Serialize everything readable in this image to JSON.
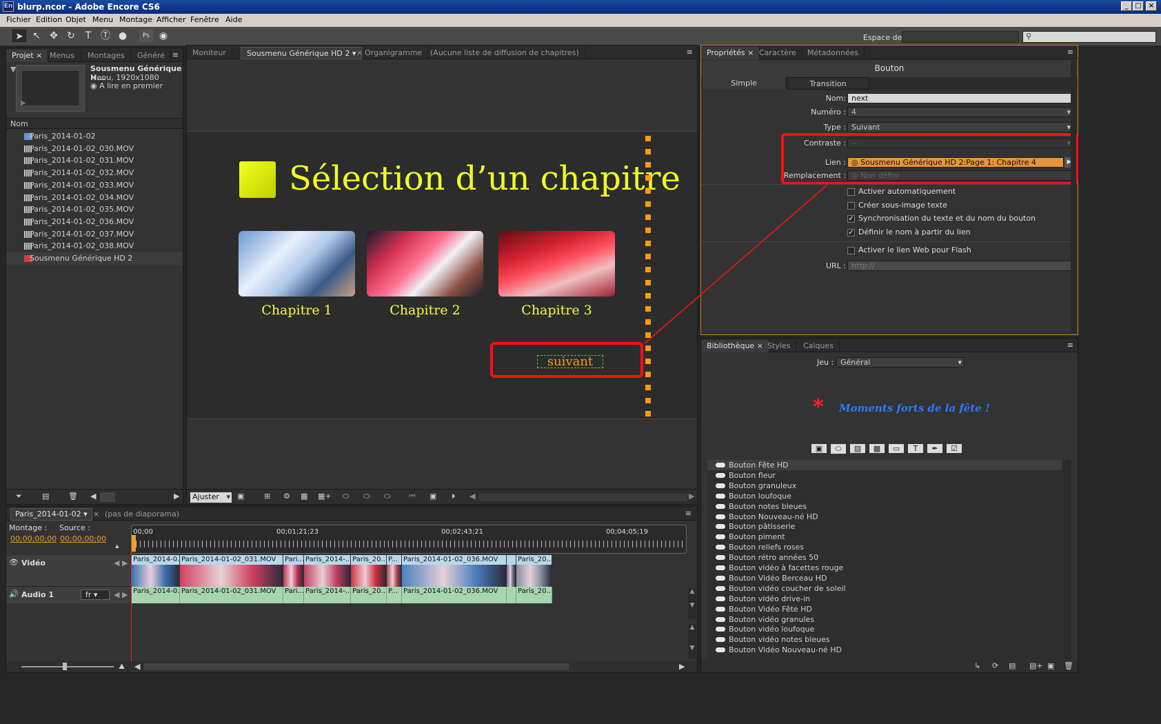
{
  "window": {
    "title": "blurp.ncor - Adobe Encore CS6",
    "app_icon": "En"
  },
  "menu": [
    "Fichier",
    "Edition",
    "Objet",
    "Menu",
    "Montage",
    "Afficher",
    "Fenêtre",
    "Aide"
  ],
  "toolbar": {
    "workspace_label": "Espace de travail :",
    "search_placeholder": ""
  },
  "project": {
    "tabs": [
      "Projet",
      "Menus",
      "Montages",
      "Généré"
    ],
    "preview": {
      "name": "Sousmenu Générique H...",
      "info": "Menu, 1920x1080",
      "first_play": "A lire en premier"
    },
    "column_header": "Nom",
    "items": [
      "Paris_2014-01-02",
      "Paris_2014-01-02_030.MOV",
      "Paris_2014-01-02_031.MOV",
      "Paris_2014-01-02_032.MOV",
      "Paris_2014-01-02_033.MOV",
      "Paris_2014-01-02_034.MOV",
      "Paris_2014-01-02_035.MOV",
      "Paris_2014-01-02_036.MOV",
      "Paris_2014-01-02_037.MOV",
      "Paris_2014-01-02_038.MOV",
      "Sousmenu Générique HD 2"
    ]
  },
  "center": {
    "tabs": [
      "Moniteur",
      "Sousmenu Générique HD 2",
      "Organigramme",
      "(Aucune liste de diffusion de chapitres)"
    ],
    "menu_title": "Sélection d’un chapitre",
    "chapters": [
      "Chapitre 1",
      "Chapitre 2",
      "Chapitre 3"
    ],
    "next_button": "suivant",
    "zoom": "Ajuster"
  },
  "properties": {
    "tabs": [
      "Propriétés",
      "Caractère",
      "Métadonnées"
    ],
    "header": "Bouton",
    "subtabs": [
      "Simple",
      "Transition"
    ],
    "fields": {
      "nom_label": "Nom:",
      "nom_value": "next",
      "numero_label": "Numéro :",
      "numero_value": "4",
      "type_label": "Type :",
      "type_value": "Suivant",
      "contraste_label": "Contraste :",
      "contraste_value": "--",
      "lien_label": "Lien :",
      "lien_value": "Sousmenu Générique HD 2:Page 1: Chapitre 4",
      "remplacement_label": "Remplacement :",
      "remplacement_value": "Non défini",
      "url_label": "URL :",
      "url_value": "http://"
    },
    "checkboxes": [
      {
        "label": "Activer automatiquement",
        "checked": false
      },
      {
        "label": "Créer sous-image texte",
        "checked": false
      },
      {
        "label": "Synchronisation du texte et du nom du bouton",
        "checked": true
      },
      {
        "label": "Définir le nom à partir du lien",
        "checked": true
      }
    ],
    "flash_checkbox": {
      "label": "Activer le lien Web pour Flash",
      "checked": false
    }
  },
  "library": {
    "tabs": [
      "Bibliothèque",
      "Styles",
      "Calques"
    ],
    "set_label": "Jeu :",
    "set_value": "Général",
    "preview_text": "Moments forts de la fête !",
    "items": [
      "Bouton Fête HD",
      "Bouton fleur",
      "Bouton granuleux",
      "Bouton loufoque",
      "Bouton notes bleues",
      "Bouton Nouveau-né HD",
      "Bouton pâtisserie",
      "Bouton piment",
      "Bouton reliefs roses",
      "Bouton rétro années 50",
      "Bouton vidéo à facettes rouge",
      "Bouton Vidéo Berceau HD",
      "Bouton vidéo coucher de soleil",
      "Bouton vidéo drive-in",
      "Bouton Vidéo Fête HD",
      "Bouton vidéo granules",
      "Bouton vidéo loufoque",
      "Bouton vidéo notes bleues",
      "Bouton Vidéo Nouveau-né HD"
    ]
  },
  "timeline": {
    "tab": "Paris_2014-01-02",
    "slideshow": "(pas de diaporama)",
    "montage_label": "Montage :",
    "montage_tc": "00;00;00;00",
    "source_label": "Source :",
    "source_tc": "00;00;00;00",
    "ruler": [
      "00;00",
      "00;01;21;23",
      "00;02;43;21",
      "00;04;05;19"
    ],
    "video_track": "Vidéo",
    "audio_track": "Audio 1",
    "audio_lang": "fr",
    "clips": [
      "Paris_2014-0...",
      "Paris_2014-01-02_031.MOV",
      "Pari...",
      "Paris_2014-...",
      "Paris_20...",
      "P...",
      "Paris_2014-01-02_036.MOV",
      "",
      "Paris_20..."
    ]
  }
}
